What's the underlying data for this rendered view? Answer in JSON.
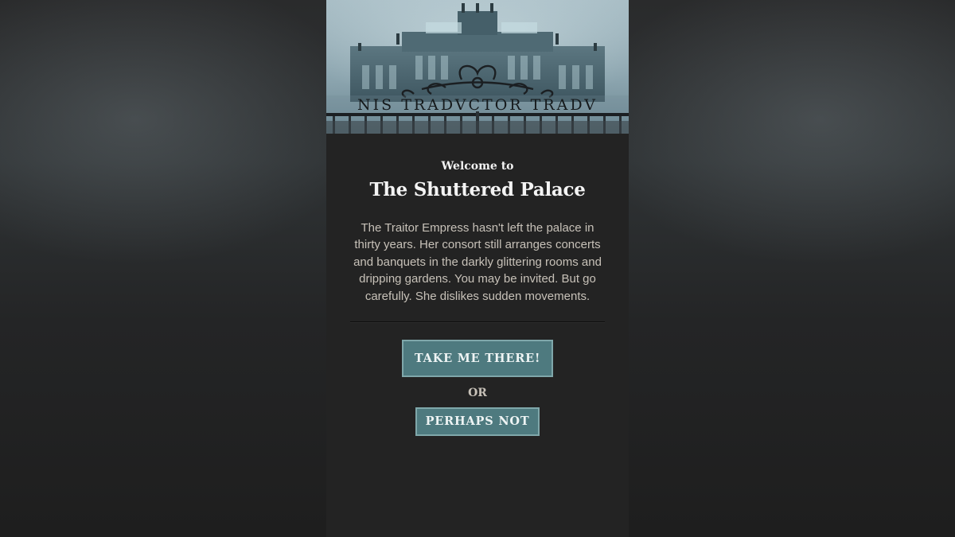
{
  "hero": {
    "gate_inscription": "NIS TRADVCTOR TRADV",
    "colors": {
      "sky": "#9db4bd",
      "building": "#4d6670",
      "iron": "#1b1f22"
    }
  },
  "intro": {
    "welcome_label": "Welcome to",
    "title": "The Shuttered Palace",
    "description": "The Traitor Empress hasn't left the palace in thirty years. Her consort still arranges concerts and banquets in the darkly glittering rooms and dripping gardens. You may be invited. But go carefully. She dislikes sudden movements."
  },
  "actions": {
    "accept_label": "TAKE ME THERE!",
    "or_label": "OR",
    "decline_label": "PERHAPS NOT"
  },
  "colors": {
    "page_background": "#1f1f1f",
    "panel_background": "#232323",
    "button_fill": "#4e7a7f",
    "button_border": "#7fa7aa",
    "body_text": "#c7c1b8"
  }
}
